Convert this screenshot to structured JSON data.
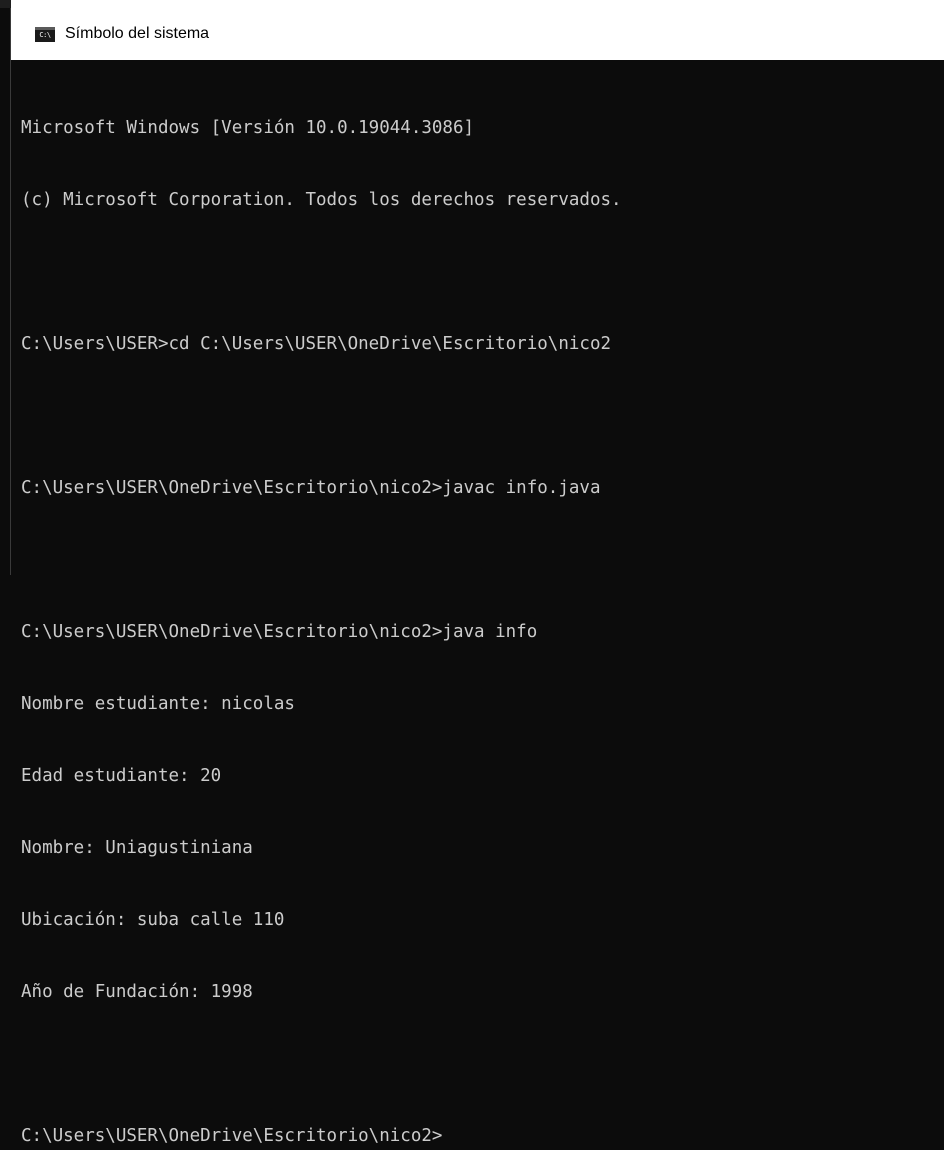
{
  "window": {
    "title": "Símbolo del sistema",
    "icon": "cmd-icon",
    "icon_text": "C:\\"
  },
  "console": {
    "lines": [
      "Microsoft Windows [Versión 10.0.19044.3086]",
      "(c) Microsoft Corporation. Todos los derechos reservados.",
      "",
      "C:\\Users\\USER>cd C:\\Users\\USER\\OneDrive\\Escritorio\\nico2",
      "",
      "C:\\Users\\USER\\OneDrive\\Escritorio\\nico2>javac info.java",
      "",
      "C:\\Users\\USER\\OneDrive\\Escritorio\\nico2>java info",
      "Nombre estudiante: nicolas",
      "Edad estudiante: 20",
      "Nombre: Uniagustiniana",
      "Ubicación: suba calle 110",
      "Año de Fundación: 1998",
      "",
      "C:\\Users\\USER\\OneDrive\\Escritorio\\nico2>"
    ]
  },
  "colors": {
    "console_background": "#0c0c0c",
    "console_text": "#cccccc",
    "titlebar_background": "#ffffff"
  }
}
